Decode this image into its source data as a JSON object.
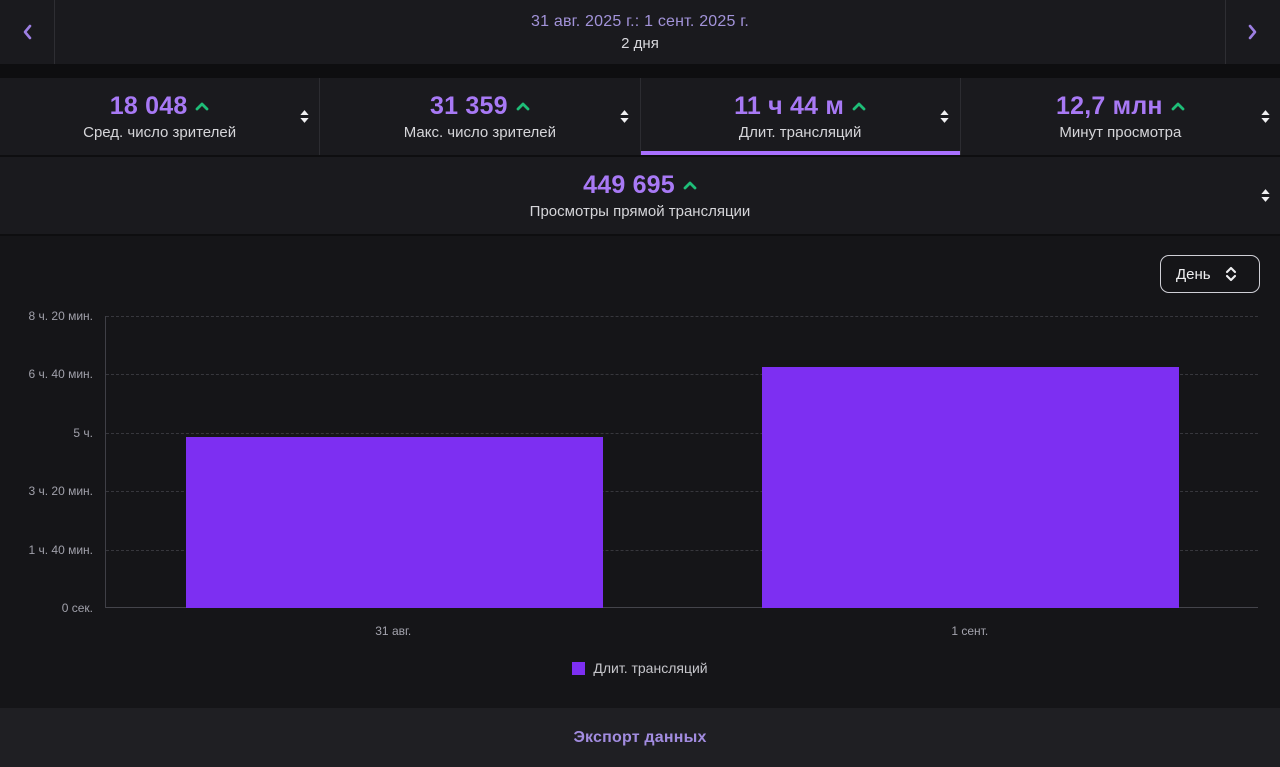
{
  "header": {
    "date_range": "31 авг. 2025 г.: 1 сент. 2025 г.",
    "duration": "2 дня"
  },
  "stats": {
    "cells": [
      {
        "value": "18 048",
        "label": "Сред. число зрителей",
        "trend": "up",
        "selected": false
      },
      {
        "value": "31 359",
        "label": "Макс. число зрителей",
        "trend": "up",
        "selected": false
      },
      {
        "value": "11 ч 44 м",
        "label": "Длит. трансляций",
        "trend": "up",
        "selected": true
      },
      {
        "value": "12,7 млн",
        "label": "Минут просмотра",
        "trend": "up",
        "selected": false
      }
    ],
    "secondary": {
      "value": "449 695",
      "label": "Просмотры прямой трансляции",
      "trend": "up"
    }
  },
  "chart_controls": {
    "granularity": "День"
  },
  "chart_data": {
    "type": "bar",
    "categories": [
      "31 авг.",
      "1 сент."
    ],
    "series": [
      {
        "name": "Длит. трансляций",
        "values_minutes": [
          292,
          412
        ]
      }
    ],
    "ylim_minutes": [
      0,
      500
    ],
    "y_ticks": [
      {
        "minutes": 0,
        "label": "0 сек."
      },
      {
        "minutes": 100,
        "label": "1 ч. 40 мин."
      },
      {
        "minutes": 200,
        "label": "3 ч. 20 мин."
      },
      {
        "minutes": 300,
        "label": "5 ч."
      },
      {
        "minutes": 400,
        "label": "6 ч. 40 мин."
      },
      {
        "minutes": 500,
        "label": "8 ч. 20 мин."
      }
    ],
    "legend": [
      {
        "label": "Длит. трансляций",
        "color": "#7d2ff2"
      }
    ],
    "grid": "dashed-horizontal",
    "legend_position": "bottom",
    "bar_color": "#7d2ff2"
  },
  "footer": {
    "export_label": "Экспорт данных"
  },
  "colors": {
    "accent_purple": "#a970ff",
    "bar_purple": "#7d2ff2",
    "trend_up_green": "#1ebe78",
    "value_purple": "#a879f5",
    "link_lavender": "#a28ce0"
  }
}
